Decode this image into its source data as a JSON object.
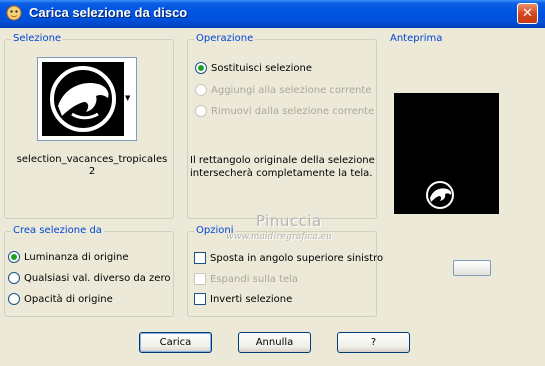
{
  "window": {
    "title": "Carica selezione da disco",
    "close_glyph": "✕"
  },
  "selezione": {
    "label": "Selezione",
    "filename_line1": "selection_vacances_tropicales",
    "filename_line2": "2"
  },
  "operazione": {
    "label": "Operazione",
    "options": [
      {
        "label": "Sostituisci selezione",
        "selected": true,
        "enabled": true
      },
      {
        "label": "Aggiungi alla selezione corrente",
        "selected": false,
        "enabled": false
      },
      {
        "label": "Rimuovi dalla selezione corrente",
        "selected": false,
        "enabled": false
      }
    ],
    "note_line1": "Il rettangolo originale della selezione",
    "note_line2": "intersecherà completamente la tela."
  },
  "anteprima": {
    "label": "Anteprima"
  },
  "crea": {
    "label": "Crea selezione da",
    "options": [
      {
        "label": "Luminanza di origine",
        "selected": true
      },
      {
        "label": "Qualsiasi val. diverso da zero",
        "selected": false
      },
      {
        "label": "Opacità di origine",
        "selected": false
      }
    ]
  },
  "opzioni": {
    "label": "Opzioni",
    "options": [
      {
        "label": "Sposta in angolo superiore sinistro",
        "checked": false,
        "enabled": true
      },
      {
        "label": "Espandi sulla tela",
        "checked": false,
        "enabled": false
      },
      {
        "label": "Inverti selezione",
        "checked": false,
        "enabled": true
      }
    ]
  },
  "watermark": {
    "line1": "Pinuccia",
    "line2": "www.maidiregrafica.eu"
  },
  "buttons": {
    "carica": "Carica",
    "annulla": "Annulla",
    "help": "?"
  },
  "colors": {
    "titlebar": "#0054e3",
    "group_label": "#0046d5",
    "radio_checked": "#21a121"
  }
}
